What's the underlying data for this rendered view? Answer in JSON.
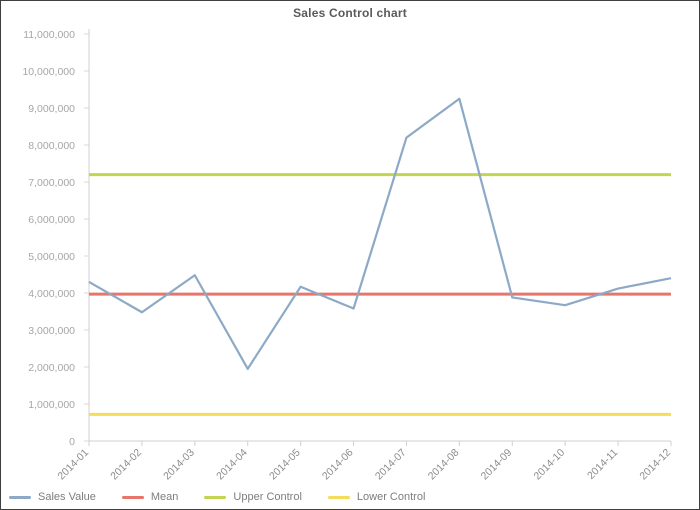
{
  "window": {
    "border_color": "#3f3f3f",
    "background": "#ffffff"
  },
  "chart_data": {
    "type": "line",
    "title": "Sales Control chart",
    "xlabel": "",
    "ylabel": "",
    "categories": [
      "2014-01",
      "2014-02",
      "2014-03",
      "2014-04",
      "2014-05",
      "2014-06",
      "2014-07",
      "2014-08",
      "2014-09",
      "2014-10",
      "2014-11",
      "2014-12"
    ],
    "series": [
      {
        "name": "Sales Value",
        "color": "#8ca9c6",
        "values": [
          4300000,
          3480000,
          4480000,
          1950000,
          4170000,
          3580000,
          8200000,
          9250000,
          3880000,
          3670000,
          4120000,
          4400000
        ]
      },
      {
        "name": "Mean",
        "color": "#e8756b",
        "constant": 3970000,
        "values": [
          3970000,
          3970000,
          3970000,
          3970000,
          3970000,
          3970000,
          3970000,
          3970000,
          3970000,
          3970000,
          3970000,
          3970000
        ]
      },
      {
        "name": "Upper Control",
        "color": "#c3d54e",
        "constant": 7200000,
        "values": [
          7200000,
          7200000,
          7200000,
          7200000,
          7200000,
          7200000,
          7200000,
          7200000,
          7200000,
          7200000,
          7200000,
          7200000
        ]
      },
      {
        "name": "Lower Control",
        "color": "#f5dc5a",
        "constant": 720000,
        "values": [
          720000,
          720000,
          720000,
          720000,
          720000,
          720000,
          720000,
          720000,
          720000,
          720000,
          720000,
          720000
        ]
      }
    ],
    "ylim": [
      0,
      11000000
    ],
    "ytick_step": 1000000,
    "ytick_labels": [
      "11,000,000",
      "10,000,000",
      "9,000,000",
      "8,000,000",
      "7,000,000",
      "6,000,000",
      "5,000,000",
      "4,000,000",
      "3,000,000",
      "2,000,000",
      "1,000,000",
      "0"
    ],
    "ytick_values": [
      11000000,
      10000000,
      9000000,
      8000000,
      7000000,
      6000000,
      5000000,
      4000000,
      3000000,
      2000000,
      1000000,
      0
    ],
    "grid": false,
    "legend_position": "bottom",
    "xtick_rotation": -45
  },
  "legend": {
    "items": [
      {
        "label": "Sales Value",
        "color": "#8ca9c6"
      },
      {
        "label": "Mean",
        "color": "#e8756b"
      },
      {
        "label": "Upper Control",
        "color": "#c3d54e"
      },
      {
        "label": "Lower Control",
        "color": "#f5dc5a"
      }
    ]
  }
}
